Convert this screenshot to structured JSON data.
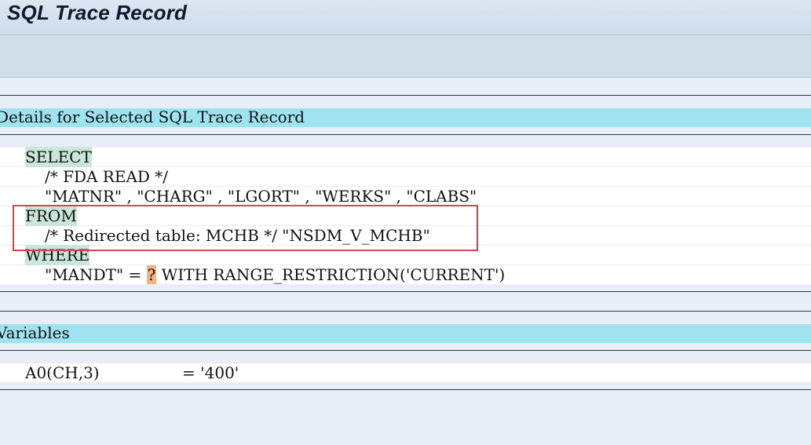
{
  "window": {
    "title": "SQL Trace Record"
  },
  "details_section": {
    "header": "Details for Selected SQL Trace Record"
  },
  "sql": {
    "select_kw": "SELECT",
    "comment_fda": "/* FDA READ */",
    "fields": "\"MATNR\" , \"CHARG\" , \"LGORT\" , \"WERKS\" , \"CLABS\"",
    "from_kw": "FROM",
    "redirect_line": "/* Redirected table: MCHB */ \"NSDM_V_MCHB\"",
    "where_kw": "WHERE",
    "where_lhs": "\"MANDT\" = ",
    "where_placeholder": "?",
    "where_rhs": " WITH RANGE_RESTRICTION('CURRENT')"
  },
  "variables_section": {
    "header": "Variables"
  },
  "variables": [
    {
      "name": "A0(CH,3)",
      "value": "= '400'"
    }
  ],
  "colors": {
    "section_header_bg": "#9fe3f0",
    "keyword_highlight": "#c9e6d9",
    "placeholder_highlight": "#f4b183",
    "annotation_box": "#d9454a"
  }
}
